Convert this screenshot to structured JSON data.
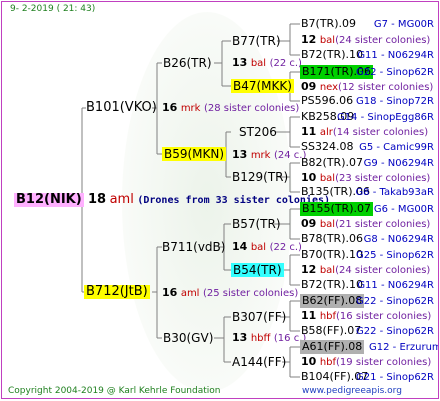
{
  "header": {
    "date": "9-  2-2019 ( 21: 43)"
  },
  "footer": {
    "copyright": "Copyright 2004-2019 @ Karl Kehrle Foundation",
    "website": "www.pedigreeapis.org"
  },
  "colors": {
    "link_blue": "#0000c0",
    "red": "#c00000",
    "highlight_yellow": "#ffff00",
    "highlight_green": "#00d000",
    "highlight_cyan": "#33ffff",
    "highlight_gray": "#b0b0b0",
    "highlight_pink": "#ffb0ff"
  },
  "root": {
    "name": "B12(NIK)",
    "year": "18",
    "race": "aml",
    "note": "(Drones from 33 sister colonies)"
  },
  "gen1": [
    {
      "name": "B101(VKO)",
      "year": "16",
      "race": "mrk",
      "colonies": "(28 sister colonies)"
    },
    {
      "name": "B712(JtB)",
      "year": "16",
      "race": "aml",
      "colonies": "(25 sister colonies)"
    }
  ],
  "gen2": [
    {
      "name": "B26(TR)",
      "year": "13",
      "race": "bal",
      "colonies": "(22 c.)"
    },
    {
      "name": "B59(MKN)",
      "year": "13",
      "race": "mrk",
      "colonies": "(24 c.)"
    },
    {
      "name": "B711(vdB)",
      "year": "14",
      "race": "bal",
      "colonies": "(22 c.)"
    },
    {
      "name": "B30(GV)",
      "year": "13",
      "race": "hbff",
      "colonies": "(16 c.)"
    }
  ],
  "gen3": [
    {
      "name": "B77(TR)"
    },
    {
      "name": "B47(MKK)"
    },
    {
      "name": "ST206"
    },
    {
      "name": "B129(TR)"
    },
    {
      "name": "B57(TR)"
    },
    {
      "name": "B54(TR)"
    },
    {
      "name": "B307(FF)"
    },
    {
      "name": "A144(FF)"
    }
  ],
  "gen4": [
    {
      "name": "B7(TR).09",
      "id": "G7 - MG00R"
    },
    {
      "year": "12",
      "race": "bal",
      "colonies": "(24 sister colonies)"
    },
    {
      "name": "B72(TR).10",
      "id": "G11 - N06294R"
    },
    {
      "name": "B171(TR).06",
      "id": "G22 - Sinop62R"
    },
    {
      "year": "09",
      "race": "nex",
      "colonies": "(12 sister colonies)"
    },
    {
      "name": "PS596.06",
      "id": "G18 - Sinop72R"
    },
    {
      "name": "KB258.09",
      "id": "G14 - SinopEgg86R"
    },
    {
      "year": "11",
      "race": "alr",
      "colonies": "(14 sister colonies)"
    },
    {
      "name": "SS324.08",
      "id": "G5 - Camic99R"
    },
    {
      "name": "B82(TR).07",
      "id": "G9 - N06294R"
    },
    {
      "year": "10",
      "race": "bal",
      "colonies": "(23 sister colonies)"
    },
    {
      "name": "B135(TR).06",
      "id": "G8 - Takab93aR"
    },
    {
      "name": "B155(TR).07",
      "id": "G6 - MG00R"
    },
    {
      "year": "09",
      "race": "bal",
      "colonies": "(21 sister colonies)"
    },
    {
      "name": "B78(TR).06",
      "id": "G8 - N06294R"
    },
    {
      "name": "B70(TR).10",
      "id": "G25 - Sinop62R"
    },
    {
      "year": "12",
      "race": "bal",
      "colonies": "(24 sister colonies)"
    },
    {
      "name": "B72(TR).10",
      "id": "G11 - N06294R"
    },
    {
      "name": "B62(FF).08",
      "id": "G22 - Sinop62R"
    },
    {
      "year": "11",
      "race": "hbf",
      "colonies": "(16 sister colonies)"
    },
    {
      "name": "B58(FF).07",
      "id": "G22 - Sinop62R"
    },
    {
      "name": "A61(FF).08",
      "id": "G12 - ErzurumEgg8"
    },
    {
      "year": "10",
      "race": "hbf",
      "colonies": "(19 sister colonies)"
    },
    {
      "name": "B104(FF).07",
      "id": "G21 - Sinop62R"
    }
  ]
}
